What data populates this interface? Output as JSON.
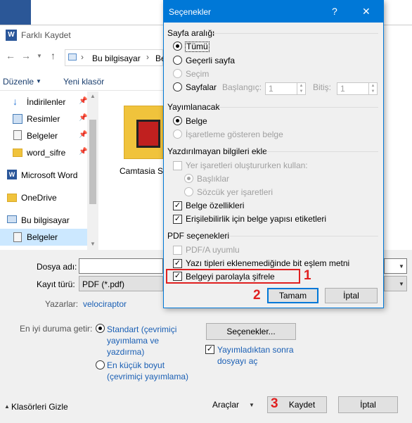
{
  "outer": {
    "title": "Farklı Kaydet",
    "breadcrumb": [
      "Bu bilgisayar",
      "Be"
    ],
    "toolbar": {
      "organize": "Düzenle",
      "new_folder": "Yeni klasör"
    },
    "nav": [
      {
        "label": "İndirilenler",
        "icon": "download-icon"
      },
      {
        "label": "Resimler",
        "icon": "pictures-icon"
      },
      {
        "label": "Belgeler",
        "icon": "documents-icon"
      },
      {
        "label": "word_sifre",
        "icon": "folder-icon"
      },
      {
        "label": "Microsoft Word",
        "icon": "word-icon"
      },
      {
        "label": "OneDrive",
        "icon": "folder-icon"
      },
      {
        "label": "Bu bilgisayar",
        "icon": "computer-icon"
      },
      {
        "label": "Belgeler",
        "icon": "documents-icon"
      }
    ],
    "folder_item": "Camtasia St",
    "filename_label": "Dosya adı:",
    "filename_value": "",
    "filetype_label": "Kayıt türü:",
    "filetype_value": "PDF (*.pdf)",
    "authors_label": "Yazarlar:",
    "authors_value": "velociraptor",
    "optimize_label": "En iyi duruma getir:",
    "optimize_standard": "Standart (çevrimiçi yayımlama ve yazdırma)",
    "optimize_min": "En küçük boyut (çevrimiçi yayımlama)",
    "options_button": "Seçenekler...",
    "open_after": "Yayımladıktan sonra dosyayı aç",
    "hide_folders": "Klasörleri Gizle",
    "tools": "Araçlar",
    "save": "Kaydet",
    "cancel": "İptal"
  },
  "dialog": {
    "title": "Seçenekler",
    "help": "?",
    "close": "✕",
    "page_range": {
      "heading": "Sayfa aralığı",
      "all": "Tümü",
      "current": "Geçerli sayfa",
      "selection": "Seçim",
      "pages": "Sayfalar",
      "from_label": "Başlangıç:",
      "from_value": "1",
      "to_label": "Bitiş:",
      "to_value": "1"
    },
    "publish": {
      "heading": "Yayımlanacak",
      "document": "Belge",
      "markup": "İşaretleme gösteren belge"
    },
    "nonprint": {
      "heading": "Yazdırılmayan bilgileri ekle",
      "bookmarks": "Yer işaretleri oluştururken kullan:",
      "headings": "Başlıklar",
      "word_bookmarks": "Sözcük yer işaretleri",
      "doc_props": "Belge özellikleri",
      "struct_tags": "Erişilebilirlik için belge yapısı etiketleri"
    },
    "pdf": {
      "heading": "PDF seçenekleri",
      "pdfa": "PDF/A uyumlu",
      "bitmap": "Yazı tipleri eklenemediğinde bit eşlem metni",
      "encrypt": "Belgeyi parolayla şifrele"
    },
    "ok": "Tamam",
    "cancel": "İptal"
  },
  "annotations": [
    "1",
    "2",
    "3"
  ],
  "colors": {
    "accent": "#0078d7",
    "annotation": "#e02020",
    "link": "#1a5fb4"
  }
}
